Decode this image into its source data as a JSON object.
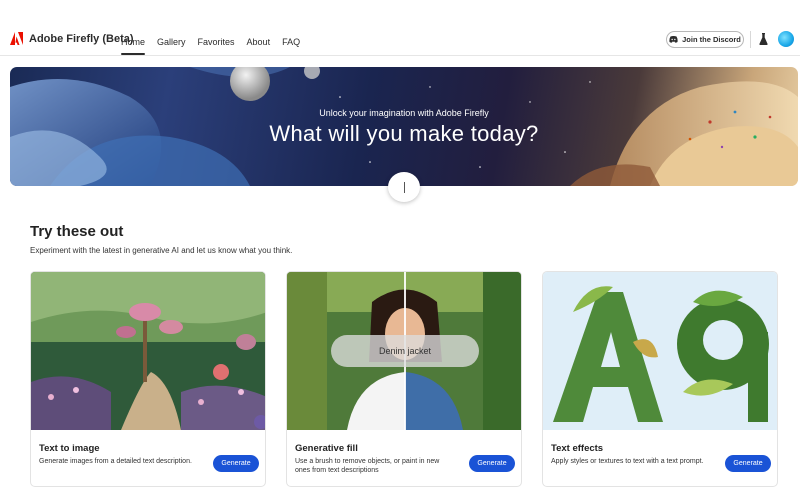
{
  "nav": {
    "brand": "Adobe Firefly (Beta)",
    "brand_icon": "adobe-logo-icon",
    "links": [
      "Home",
      "Gallery",
      "Favorites",
      "About",
      "FAQ"
    ],
    "active_link": "Home",
    "discord_label": "Join the Discord",
    "colors": {
      "brand_red": "#eb1000",
      "avatar": "#1aa8e8"
    }
  },
  "hero": {
    "subtitle": "Unlock your imagination with Adobe Firefly",
    "title": "What will you make today?"
  },
  "section": {
    "title": "Try these out",
    "subtitle": "Experiment with the latest in generative AI and let us know what you think."
  },
  "cards": [
    {
      "title": "Text to image",
      "description": "Generate images from a detailed text description.",
      "button": "Generate"
    },
    {
      "title": "Generative fill",
      "description": "Use a brush to remove objects, or paint in new ones from text descriptions",
      "button": "Generate",
      "overlay_text": "Denim jacket"
    },
    {
      "title": "Text effects",
      "description": "Apply styles or textures to text with a text prompt.",
      "button": "Generate"
    }
  ],
  "colors": {
    "accent_button": "#1a53d6"
  }
}
